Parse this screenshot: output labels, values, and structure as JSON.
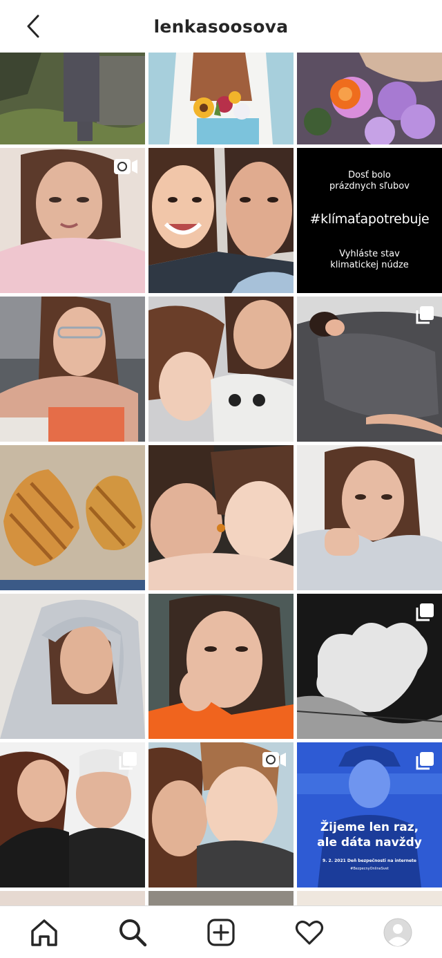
{
  "header": {
    "username": "lenkasoosova",
    "back_icon": "chevron-left-icon"
  },
  "posts": [
    {
      "badge": "none",
      "desc": "person in long coat outdoors"
    },
    {
      "badge": "none",
      "desc": "woman holding flower pot"
    },
    {
      "badge": "none",
      "desc": "bouquet of flowers"
    },
    {
      "badge": "video",
      "desc": "woman selfie"
    },
    {
      "badge": "none",
      "desc": "mother and child selfie"
    },
    {
      "badge": "none",
      "desc": "climate text graphic",
      "text_top": "Dosť bolo\nprázdnych sľubov",
      "text_main": "#klímaťapotrebuje",
      "text_bottom": "Vyhláste stav\nklimatickej núdze"
    },
    {
      "badge": "none",
      "desc": "woman with glasses and box"
    },
    {
      "badge": "none",
      "desc": "woman with child lying"
    },
    {
      "badge": "carousel",
      "desc": "woman sleeping in bed"
    },
    {
      "badge": "none",
      "desc": "two croissants"
    },
    {
      "badge": "none",
      "desc": "woman hugging child"
    },
    {
      "badge": "none",
      "desc": "woman in grey sweater"
    },
    {
      "badge": "none",
      "desc": "woman in hoodie"
    },
    {
      "badge": "none",
      "desc": "woman close-up orange top"
    },
    {
      "badge": "carousel",
      "desc": "heart-shaped cloud"
    },
    {
      "badge": "carousel",
      "desc": "woman with older man"
    },
    {
      "badge": "video",
      "desc": "woman kissing child"
    },
    {
      "badge": "carousel",
      "desc": "blue campaign graphic",
      "text_main": "Žijeme len raz,\nale dáta navždy",
      "text_small": "9. 2. 2021 Deň bezpečnosti na internete",
      "text_tag": "#BezpecnyOnlineSvet"
    }
  ],
  "nav": {
    "items": [
      "home-icon",
      "search-icon",
      "new-post-icon",
      "activity-icon",
      "profile-avatar"
    ]
  },
  "colors": {
    "text": "#262626",
    "divider": "#dbdbdb",
    "campaign_blue": "#2f5fd8"
  }
}
